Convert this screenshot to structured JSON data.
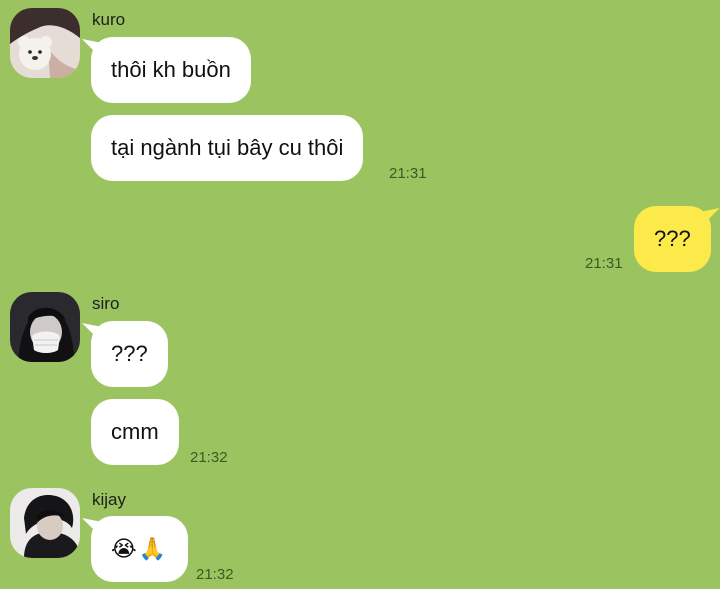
{
  "messages": [
    {
      "sender": "kuro",
      "avatar": "avatar-kuro-with-plush-bear",
      "texts": [
        "thôi kh buồn",
        "tại ngành tụi bây cu thôi"
      ],
      "time": "21:31"
    },
    {
      "sender": "me",
      "texts": [
        "???"
      ],
      "time": "21:31"
    },
    {
      "sender": "siro",
      "avatar": "avatar-siro-masked",
      "texts": [
        "???",
        "cmm"
      ],
      "time": "21:32"
    },
    {
      "sender": "kijay",
      "avatar": "avatar-kijay",
      "texts": [
        "😭🙏"
      ],
      "time": "21:32"
    }
  ],
  "colors": {
    "background": "#9bc35f",
    "incoming_bubble": "#ffffff",
    "outgoing_bubble": "#fce94a",
    "timestamp": "#3c5a23"
  }
}
